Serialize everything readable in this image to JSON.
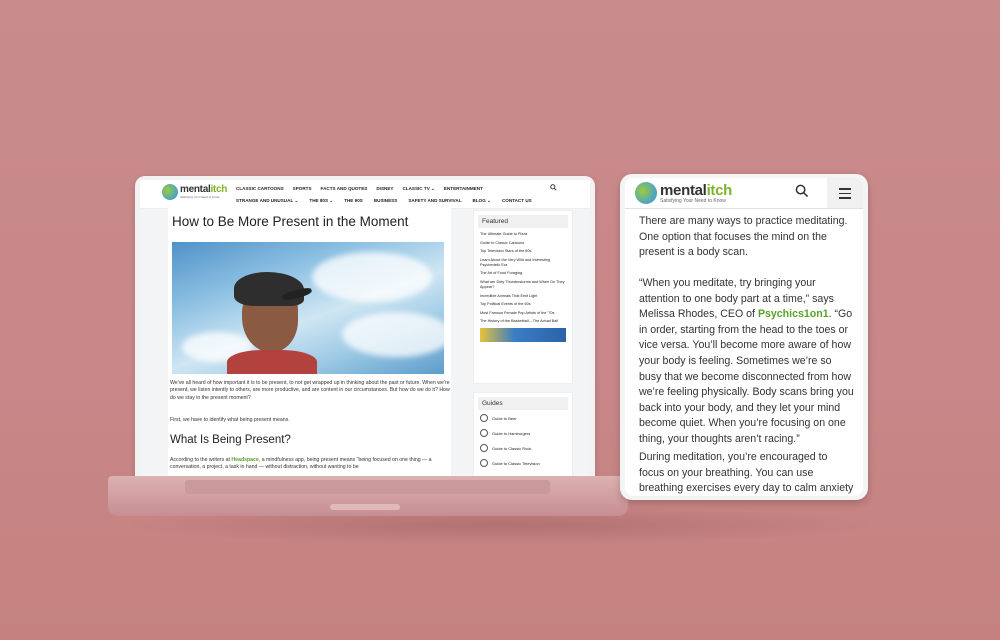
{
  "colors": {
    "background": "#c98a8b",
    "brand_green": "#5aa12a",
    "text": "#333333"
  },
  "laptop": {
    "logo": {
      "name_plain": "mental",
      "name_green": "itch",
      "tagline": "Satisfying Your Need to Know"
    },
    "nav_row1": [
      "CLASSIC CARTOONS",
      "SPORTS",
      "FACTS AND QUOTES",
      "DISNEY",
      "CLASSIC TV",
      "ENTERTAINMENT"
    ],
    "nav_row2": [
      "STRANGE AND UNUSUAL",
      "THE 80S",
      "THE 90S",
      "BUSINESS",
      "SAFETY AND SURVIVAL",
      "BLOG",
      "CONTACT US"
    ],
    "search_icon": "search-icon",
    "article": {
      "title": "How to Be More Present in the Moment",
      "para1": "We’ve all heard of how important it is to be present, to not get wrapped up in thinking about the past or future. When we’re present, we listen intently to others, are more productive, and are content in our circumstances. But how do we do it? How do we stay in the present moment?",
      "para2": "First, we have to identify what being present means.",
      "h2": "What Is Being Present?",
      "para3_before": "According to the writers at ",
      "para3_link": "Headspace",
      "para3_after": ", a mindfulness app, being present means “being focused on one thing — a conversation, a project, a task in hand — without distraction, without wanting to be"
    },
    "sidebar": {
      "featured_heading": "Featured",
      "featured_items": [
        "The Ultimate Guide to Pizza",
        "Guide to Classic Cartoons",
        "Top Television Stars of the 60s",
        "Learn About the Very Wild and Interesting Psychedelic Era",
        "The Art of Food Foraging",
        "What are Dirty Thunderstorms and When Do They Appear?",
        "Incredible Animals That Emit Light",
        "Top Political Events of the 60s",
        "Most Famous Female Pop Artists of the '70s",
        "The History of the Basketball – The Actual Ball"
      ],
      "guides_heading": "Guides",
      "guides_items": [
        "Guide to Beer",
        "Guide to Hamburgers",
        "Guide to Classic Rock",
        "Guide to Classic Television"
      ]
    }
  },
  "phone": {
    "logo": {
      "name_plain": "mental",
      "name_green": "itch",
      "tagline": "Satisfying Your Need to Know"
    },
    "para1": "There are many ways to practice meditating. One option that focuses the mind on the present is a body scan.",
    "para2_before": "“When you meditate, try bringing your attention to one body part at a time,” says Melissa Rhodes, CEO of ",
    "para2_link": "Psychics1on1",
    "para2_after": ". “Go in order, starting from the head to the toes or vice versa. You’ll become more aware of how your body is feeling. Sometimes we’re so busy that we become disconnected from how we’re feeling physically. Body scans bring you back into your body, and they let your mind become quiet. When you’re focusing on one thing, your thoughts aren’t racing.”",
    "para3": "During meditation, you’re encouraged to focus on your breathing. You can use breathing exercises every day to calm anxiety and"
  }
}
